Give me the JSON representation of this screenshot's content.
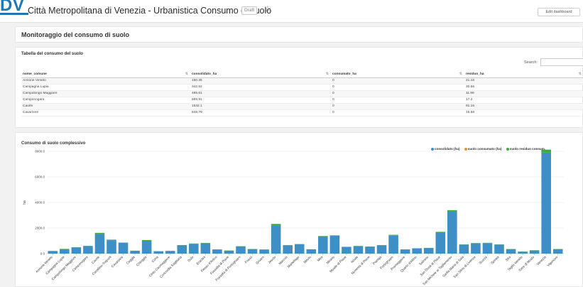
{
  "header": {
    "logo_text": "DV",
    "title": "Città Metropolitana di Venezia - Urbanistica Consumo di suolo",
    "badge": "Draft",
    "edit_label": "Edit dashboard"
  },
  "section_title": "Monitoraggio del consumo di suolo",
  "table": {
    "title": "Tabella del consumo del suolo",
    "search_label": "Search:",
    "columns": [
      "nome_comune",
      "consolidato_ha",
      "consumato_ha",
      "residuo_ha"
    ],
    "rows": [
      [
        "Annone Veneto",
        "190.35",
        "0",
        "21.16"
      ],
      [
        "Campagna Lupia",
        "342.52",
        "0",
        "30.56"
      ],
      [
        "Campolongo Maggiore",
        "485.61",
        "0",
        "11.99"
      ],
      [
        "Camponogara",
        "589.91",
        "0",
        "17.2"
      ],
      [
        "Caorle",
        "1532.1",
        "0",
        "91.16"
      ],
      [
        "Cavarzere",
        "848.79",
        "0",
        "16.58"
      ]
    ]
  },
  "chart": {
    "title": "Consumo di suolo complessivo",
    "colors": {
      "consolidato": "#3d8fc6",
      "consumato": "#f28e2b",
      "residuo": "#3bab3b"
    }
  },
  "chart_data": {
    "type": "bar",
    "stacked": true,
    "ylabel": "ha",
    "ylim": [
      0,
      8000
    ],
    "yticks": [
      "0.0",
      "2000.0",
      "4000.0",
      "6000.0",
      "8000.0"
    ],
    "grid": true,
    "legend_position": "top-right",
    "categories": [
      "Annone Veneto",
      "Campagna Lupia",
      "Campolongo Maggiore",
      "Camponogara",
      "Caorle",
      "Cavallino-Treporti",
      "Cavarzere",
      "Ceggia",
      "Chioggia",
      "Cona",
      "Cinto Caomaggiore",
      "Concordia Sagittaria",
      "Dolo",
      "Eraclea",
      "Fiesso d'Artico",
      "Fossalta di Piave",
      "Fossalta di Portogruaro",
      "Fossò",
      "Gruaro",
      "Jesolo",
      "Marcon",
      "Martellago",
      "Meolo",
      "Mira",
      "Mirano",
      "Musile di Piave",
      "Noale",
      "Noventa di Piave",
      "Pianiga",
      "Portogruaro",
      "Pramaggiore",
      "Quarto d'Altino",
      "Salzano",
      "San Donà di Piave",
      "San Michele al Tagliamento",
      "Santa Maria di Sala",
      "San Stino di Livenza",
      "Scorzè",
      "Spinea",
      "Stra",
      "Teglio Veneto",
      "Torre di Mosto",
      "Venezia",
      "Vigonovo"
    ],
    "series": [
      {
        "name": "consolidato (ha)",
        "values": [
          190,
          343,
          486,
          590,
          1532,
          1050,
          849,
          220,
          1000,
          180,
          200,
          640,
          760,
          800,
          320,
          230,
          560,
          350,
          310,
          2200,
          650,
          730,
          330,
          1350,
          1400,
          520,
          580,
          540,
          650,
          1430,
          320,
          410,
          440,
          1640,
          3300,
          700,
          800,
          820,
          700,
          350,
          150,
          250,
          7900,
          350
        ]
      },
      {
        "name": "suolo consumato (ha)",
        "values": [
          0,
          0,
          0,
          0,
          0,
          0,
          0,
          0,
          0,
          0,
          0,
          0,
          0,
          0,
          0,
          0,
          0,
          0,
          0,
          0,
          0,
          0,
          0,
          0,
          0,
          0,
          0,
          0,
          0,
          0,
          0,
          0,
          0,
          0,
          0,
          0,
          0,
          0,
          0,
          0,
          0,
          0,
          0,
          0
        ]
      },
      {
        "name": "suolo residuo consum.",
        "values": [
          21,
          31,
          12,
          17,
          91,
          40,
          17,
          10,
          60,
          10,
          10,
          25,
          30,
          35,
          10,
          10,
          20,
          15,
          10,
          120,
          20,
          20,
          10,
          30,
          30,
          15,
          20,
          15,
          20,
          40,
          10,
          10,
          10,
          60,
          100,
          20,
          25,
          25,
          20,
          10,
          5,
          10,
          230,
          10
        ]
      }
    ]
  }
}
